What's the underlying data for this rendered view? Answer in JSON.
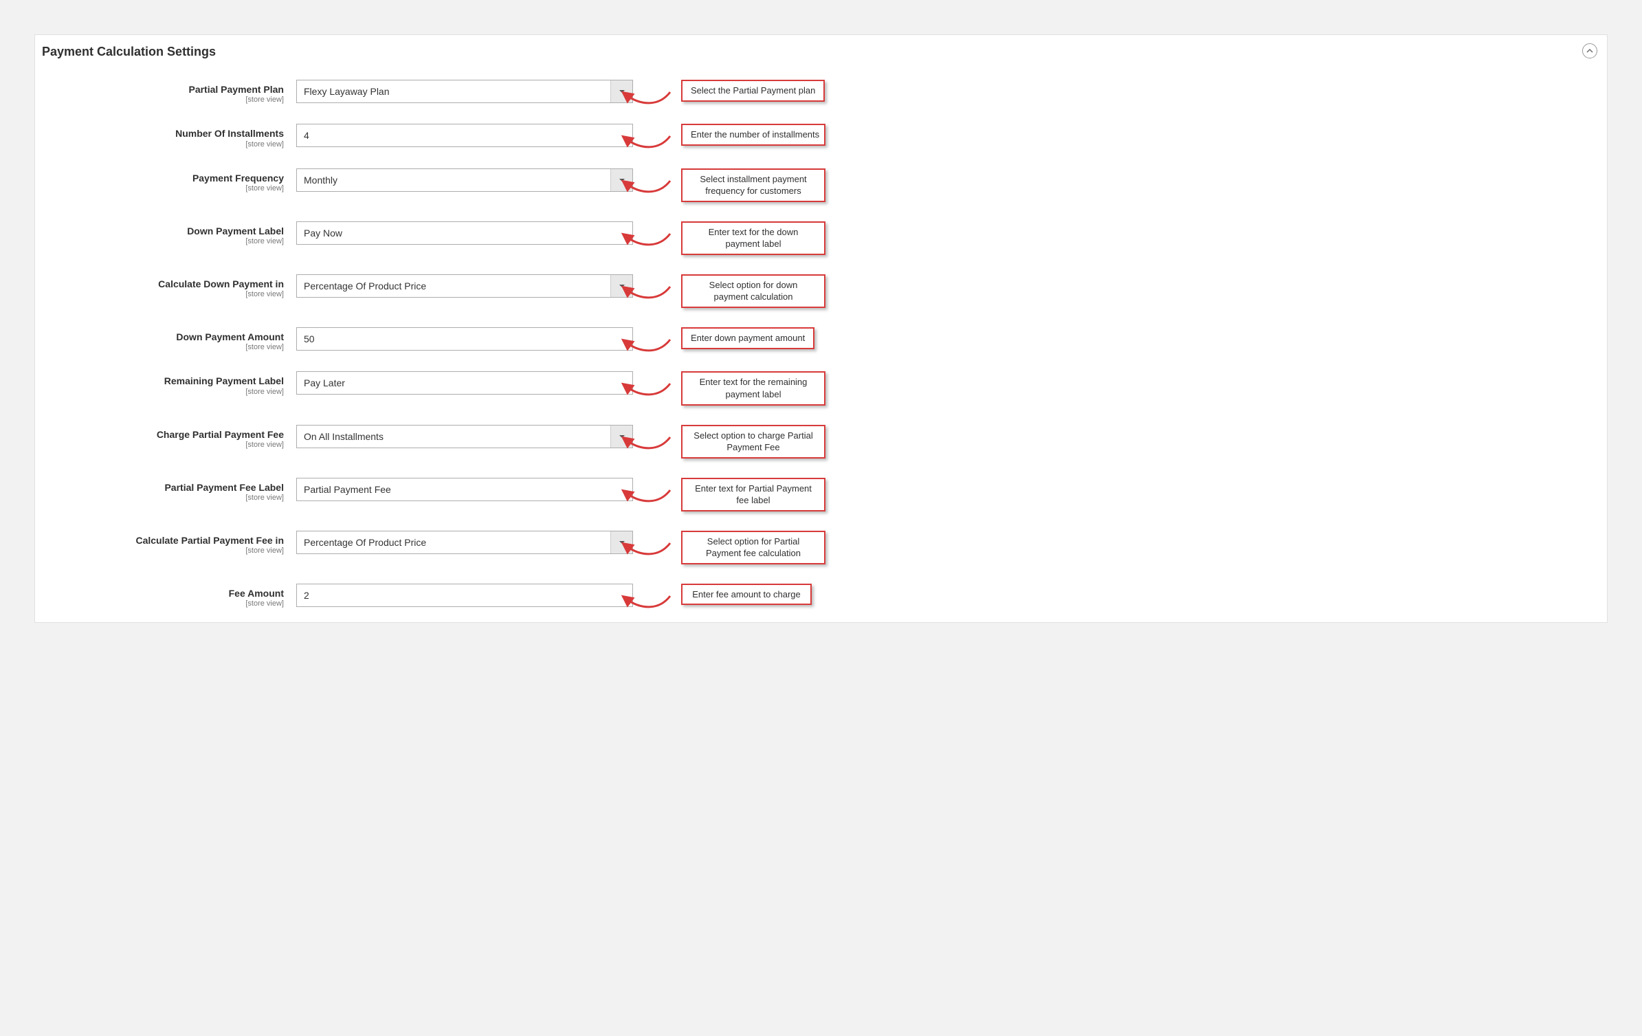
{
  "section_title": "Payment Calculation Settings",
  "scope_label": "[store view]",
  "rows": [
    {
      "label": "Partial Payment Plan",
      "type": "select",
      "value": "Flexy Layaway Plan",
      "callout": "Select the Partial Payment plan",
      "callout_lines": 1
    },
    {
      "label": "Number Of Installments",
      "type": "text",
      "value": "4",
      "callout": "Enter the number of installments",
      "callout_lines": 1
    },
    {
      "label": "Payment Frequency",
      "type": "select",
      "value": "Monthly",
      "callout": "Select installment payment frequency for customers",
      "callout_lines": 2
    },
    {
      "label": "Down Payment Label",
      "type": "text",
      "value": "Pay Now",
      "callout": "Enter text for the down payment label",
      "callout_lines": 2
    },
    {
      "label": "Calculate Down Payment in",
      "type": "select",
      "value": "Percentage Of Product Price",
      "callout": "Select option for down payment calculation",
      "callout_lines": 2
    },
    {
      "label": "Down Payment Amount",
      "type": "text",
      "value": "50",
      "callout": "Enter down payment amount",
      "callout_lines": 1
    },
    {
      "label": "Remaining Payment Label",
      "type": "text",
      "value": "Pay Later",
      "callout": "Enter text for the remaining payment label",
      "callout_lines": 2
    },
    {
      "label": "Charge Partial Payment Fee",
      "type": "select",
      "value": "On All Installments",
      "callout": "Select option to charge Partial Payment Fee",
      "callout_lines": 2
    },
    {
      "label": "Partial Payment Fee Label",
      "type": "text",
      "value": "Partial Payment Fee",
      "callout": "Enter text for Partial Payment fee label",
      "callout_lines": 2
    },
    {
      "label": "Calculate Partial Payment Fee in",
      "type": "select",
      "value": "Percentage Of Product Price",
      "callout": "Select option for Partial Payment fee calculation",
      "callout_lines": 2
    },
    {
      "label": "Fee Amount",
      "type": "text",
      "value": "2",
      "callout": "Enter fee amount to charge",
      "callout_lines": 1
    }
  ]
}
